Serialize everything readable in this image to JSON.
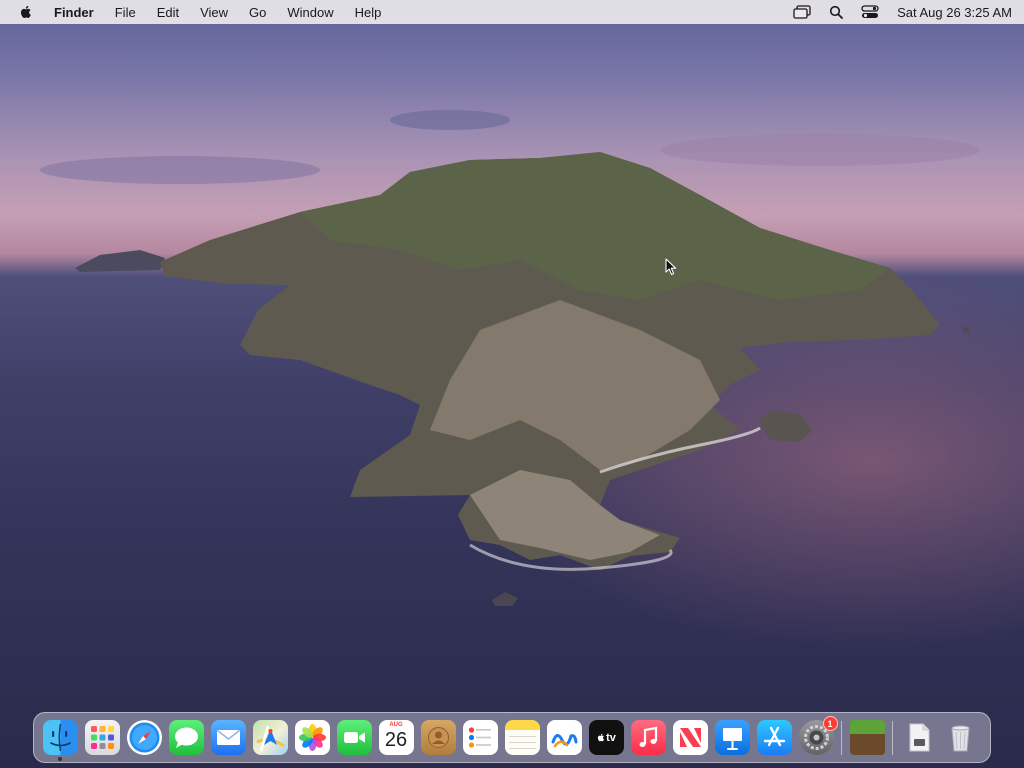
{
  "menubar": {
    "apple_icon": "apple-logo-icon",
    "app_name": "Finder",
    "menus": [
      "File",
      "Edit",
      "View",
      "Go",
      "Window",
      "Help"
    ],
    "status_icons": [
      "screen-mirroring-icon",
      "spotlight-search-icon",
      "control-center-icon"
    ],
    "clock": "Sat Aug 26  3:25 AM"
  },
  "dock": {
    "apps": [
      {
        "name": "Finder",
        "icon": "finder-icon",
        "running": true
      },
      {
        "name": "Launchpad",
        "icon": "launchpad-icon"
      },
      {
        "name": "Safari",
        "icon": "safari-icon"
      },
      {
        "name": "Messages",
        "icon": "messages-icon"
      },
      {
        "name": "Mail",
        "icon": "mail-icon"
      },
      {
        "name": "Maps",
        "icon": "maps-icon"
      },
      {
        "name": "Photos",
        "icon": "photos-icon"
      },
      {
        "name": "FaceTime",
        "icon": "facetime-icon"
      },
      {
        "name": "Calendar",
        "icon": "calendar-icon",
        "month": "AUG",
        "day": "26"
      },
      {
        "name": "Contacts",
        "icon": "contacts-icon"
      },
      {
        "name": "Reminders",
        "icon": "reminders-icon"
      },
      {
        "name": "Notes",
        "icon": "notes-icon"
      },
      {
        "name": "Freeform",
        "icon": "freeform-icon"
      },
      {
        "name": "TV",
        "icon": "apple-tv-icon",
        "label": "tv"
      },
      {
        "name": "Music",
        "icon": "music-icon"
      },
      {
        "name": "News",
        "icon": "news-icon"
      },
      {
        "name": "Keynote",
        "icon": "keynote-icon"
      },
      {
        "name": "App Store",
        "icon": "app-store-icon"
      },
      {
        "name": "System Settings",
        "icon": "settings-gear-icon",
        "badge": "1"
      },
      {
        "name": "Minecraft",
        "icon": "minecraft-grass-block-icon"
      },
      {
        "name": "Document",
        "icon": "document-file-icon"
      },
      {
        "name": "Trash",
        "icon": "trash-icon"
      }
    ]
  },
  "colors": {
    "menubar_bg": "#ece8ec",
    "badge_red": "#ff3b30",
    "sky_top": "#5b5f95",
    "sky_horizon": "#c59fb4",
    "sea": "#34345a"
  }
}
